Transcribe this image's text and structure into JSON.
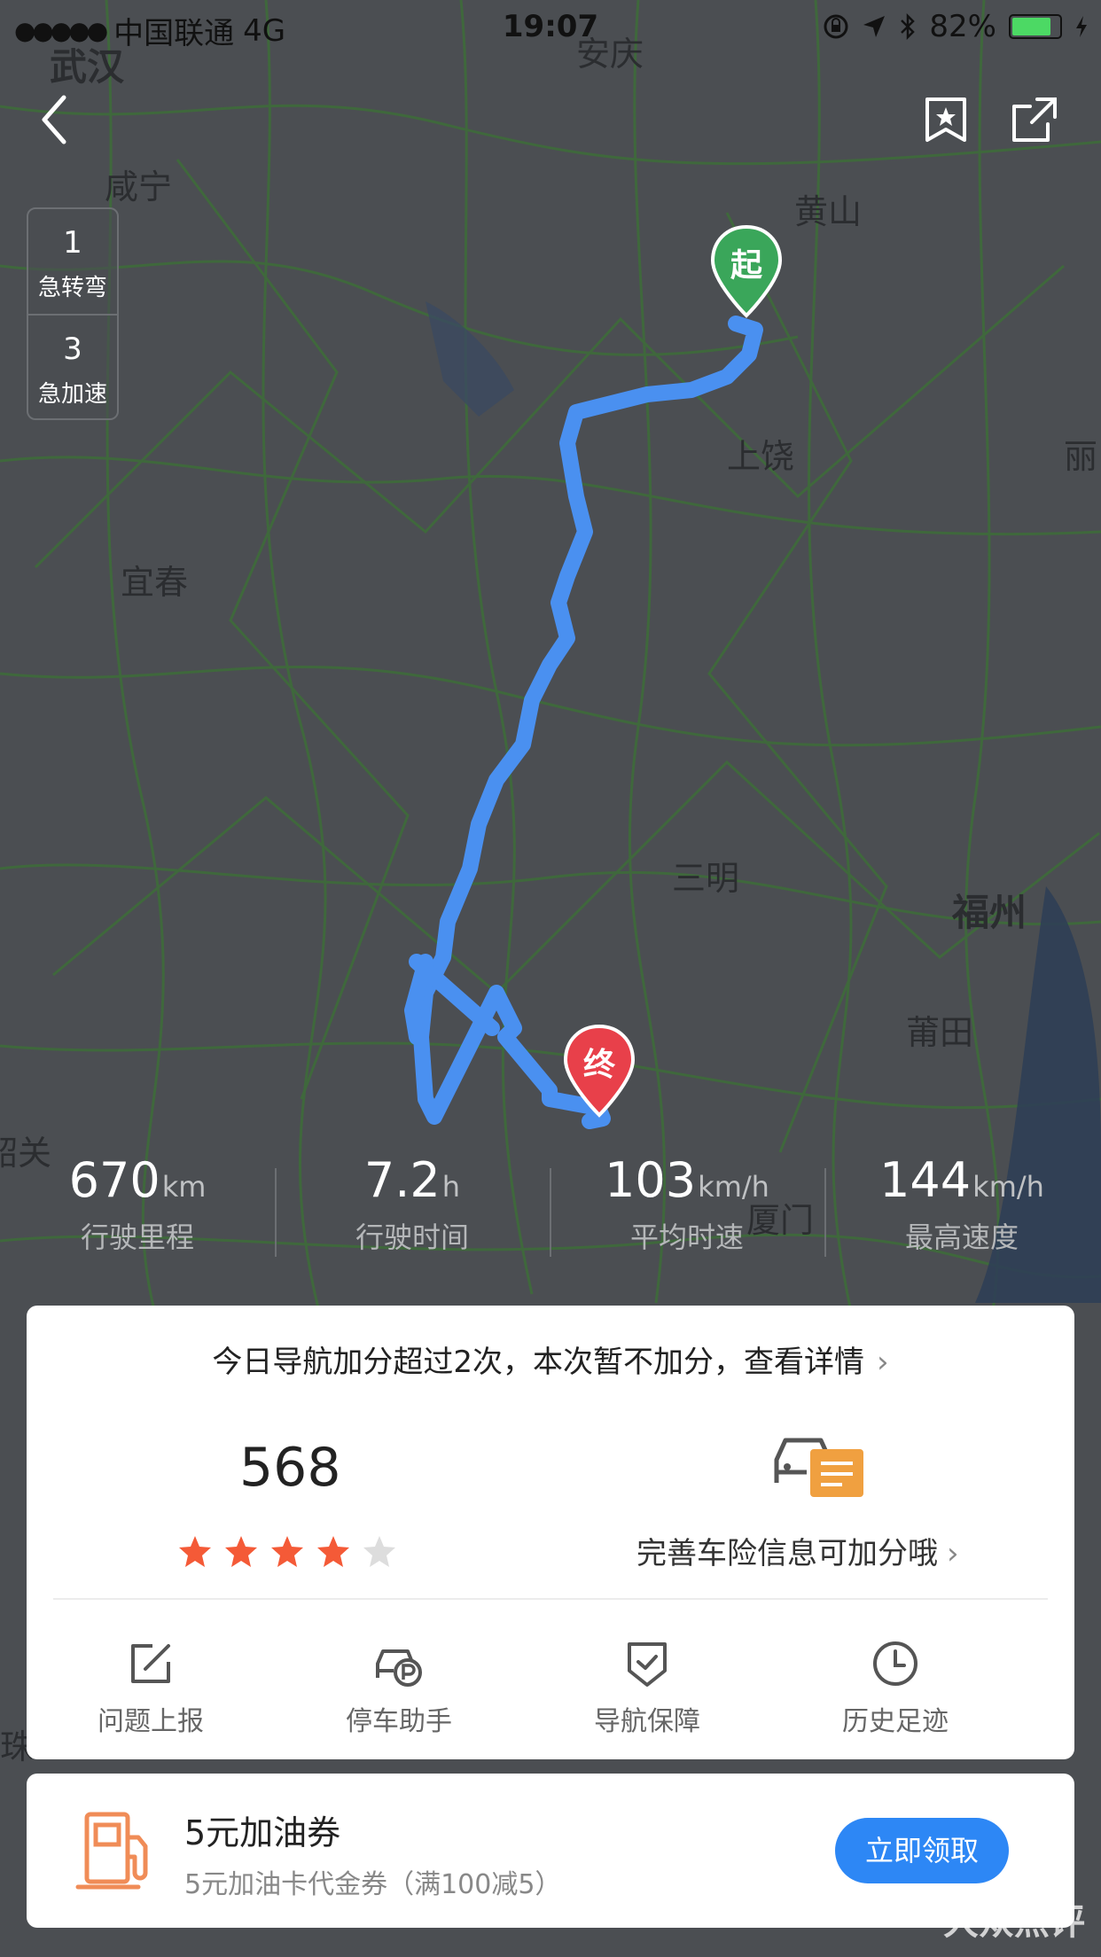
{
  "status_bar": {
    "signal": "●●●●●",
    "carrier": "中国联通",
    "network": "4G",
    "time": "19:07",
    "battery": "82%"
  },
  "map": {
    "cities": [
      "武汉",
      "安庆",
      "咸宁",
      "黄山",
      "上饶",
      "丽",
      "宜春",
      "三明",
      "福州",
      "莆田",
      "韶关",
      "厦门",
      "珠"
    ],
    "start_marker": "起",
    "end_marker": "终"
  },
  "events": [
    {
      "count": "1",
      "label": "急转弯"
    },
    {
      "count": "3",
      "label": "急加速"
    }
  ],
  "stats": [
    {
      "value": "670",
      "unit": "km",
      "label": "行驶里程"
    },
    {
      "value": "7.2",
      "unit": "h",
      "label": "行驶时间"
    },
    {
      "value": "103",
      "unit": "km/h",
      "label": "平均时速"
    },
    {
      "value": "144",
      "unit": "km/h",
      "label": "最高速度"
    }
  ],
  "card": {
    "notice": "今日导航加分超过2次，本次暂不加分，查看详情",
    "score": "568",
    "rating": {
      "value": 4,
      "max": 5
    },
    "car_insurance_text": "完善车险信息可加分哦",
    "tools": [
      {
        "icon": "edit-icon",
        "label": "问题上报"
      },
      {
        "icon": "parking-car-icon",
        "label": "停车助手"
      },
      {
        "icon": "shield-check-icon",
        "label": "导航保障"
      },
      {
        "icon": "clock-icon",
        "label": "历史足迹"
      }
    ]
  },
  "coupon": {
    "title": "5元加油券",
    "subtitle": "5元加油卡代金券（满100减5）",
    "button": "立即领取"
  },
  "watermark": "大众点评",
  "colors": {
    "route": "#4a90f0",
    "start_pin": "#3aa65a",
    "end_pin": "#e8404a",
    "star_on": "#f45a37",
    "star_off": "#dddddd",
    "accent": "#2d87f5",
    "coupon_icon": "#f08c57"
  }
}
